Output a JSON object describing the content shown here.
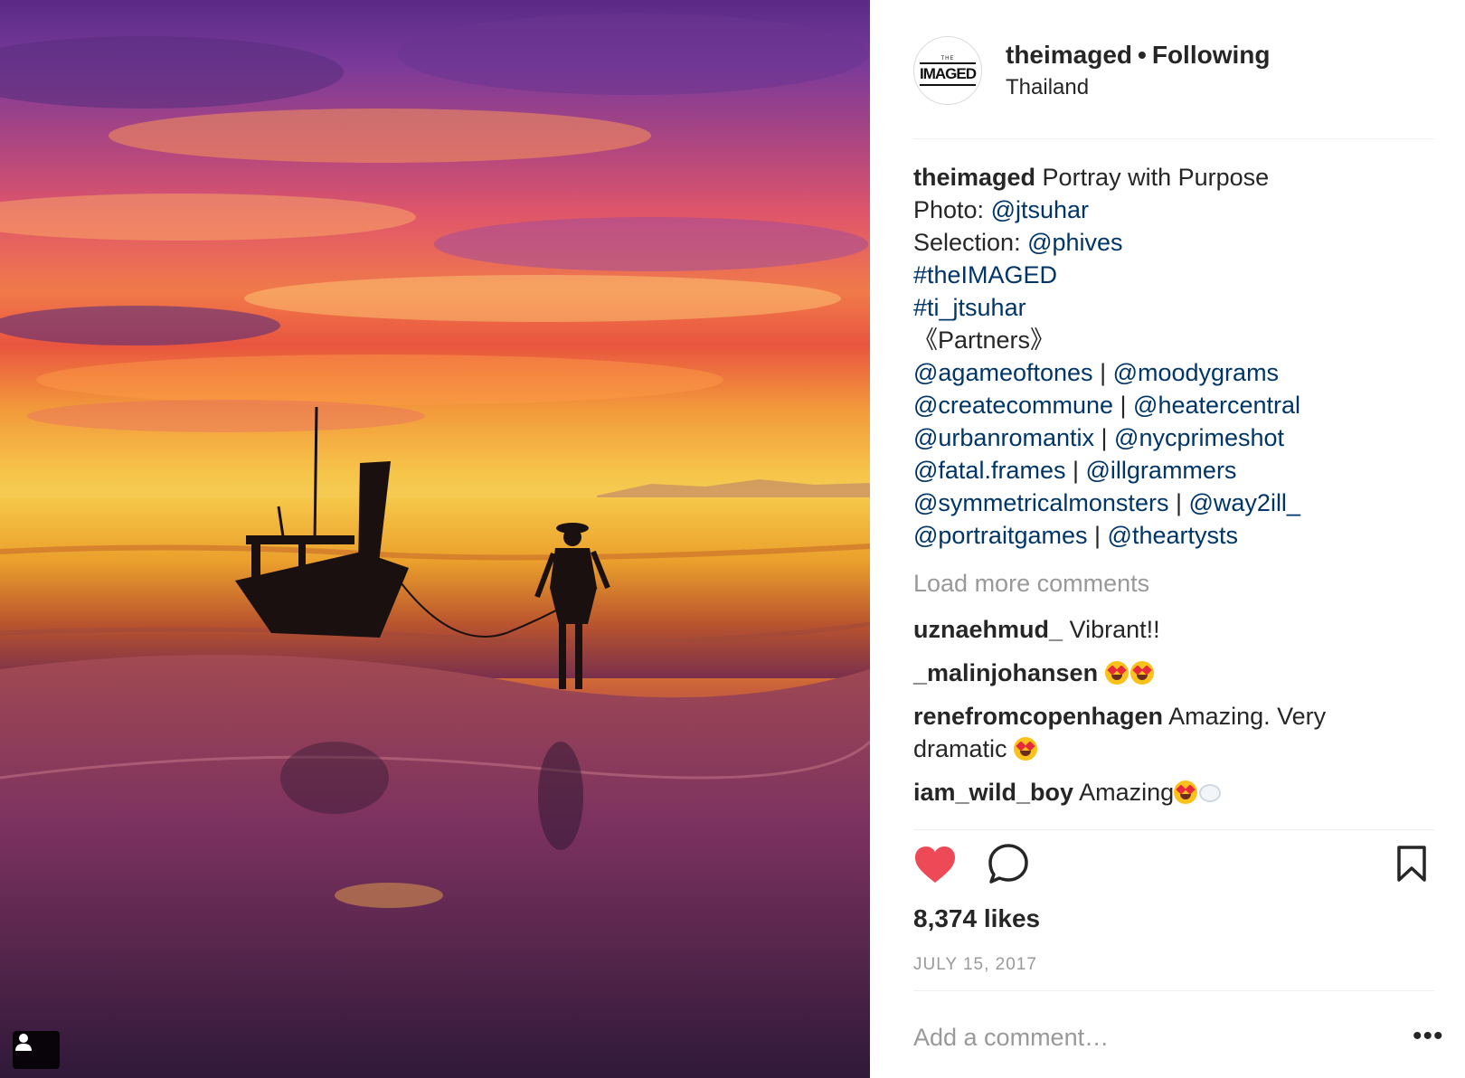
{
  "post": {
    "author": "theimaged",
    "dot": "•",
    "follow_status": "Following",
    "location": "Thailand",
    "avatar_logo_small": "THE",
    "avatar_logo_main": "IMAGED"
  },
  "caption": {
    "username": "theimaged",
    "text": "Portray with Purpose",
    "photo_label": "Photo:",
    "photo_credit": "@jtsuhar",
    "selection_label": "Selection:",
    "selection_credit": "@phives",
    "hashtag1": "#theIMAGED",
    "hashtag2": "#ti_jtsuhar",
    "partners_heading": "《Partners》",
    "separator": "|",
    "partners": [
      [
        "@agameoftones",
        "@moodygrams"
      ],
      [
        "@createcommune",
        "@heatercentral"
      ],
      [
        "@urbanromantix",
        "@nycprimeshot"
      ],
      [
        "@fatal.frames",
        "@illgrammers"
      ],
      [
        "@symmetricalmonsters",
        "@way2ill_"
      ],
      [
        "@portraitgames",
        "@theartysts"
      ]
    ]
  },
  "load_more": "Load more comments",
  "comments": [
    {
      "user": "uznaehmud_",
      "text": "Vibrant!!"
    },
    {
      "user": "_malinjohansen",
      "text": ""
    },
    {
      "user": "renefromcopenhagen",
      "text": "Amazing. Very",
      "text2": "dramatic"
    },
    {
      "user": "iam_wild_boy",
      "text": "Amazing"
    }
  ],
  "actions": {
    "like_icon": "heart-icon",
    "comment_icon": "comment-icon",
    "save_icon": "bookmark-icon",
    "like_color": "#ed4956"
  },
  "likes": "8,374 likes",
  "date": "JULY 15, 2017",
  "add_comment_placeholder": "Add a comment…",
  "more_options": "•••",
  "colors": {
    "link": "#003569",
    "text": "#262626",
    "muted": "#999999",
    "divider": "#efefef"
  }
}
